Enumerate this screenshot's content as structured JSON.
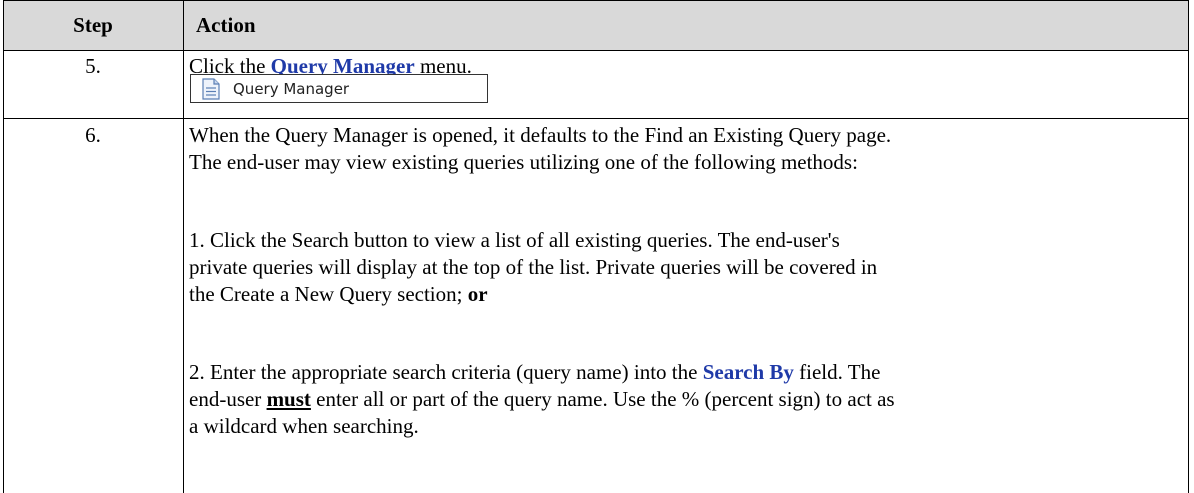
{
  "header": {
    "step": "Step",
    "action": "Action"
  },
  "rows": [
    {
      "step": "5.",
      "pre": "Click the ",
      "bold": "Query Manager",
      "post": " menu.",
      "image_label": "Query Manager"
    },
    {
      "step": "6.",
      "intro_line1": "When the Query Manager is opened, it defaults to the Find an Existing Query page.",
      "intro_line2": "The end-user may view existing queries utilizing one of the following methods:",
      "m1_line1": "1. Click the Search button to view a list of all existing queries. The end-user's",
      "m1_line2": "private queries will display at the top of the list. Private queries will be covered in",
      "m1_line3a": "the Create a New Query section; ",
      "m1_line3b": "or",
      "m2_line1a": "2. Enter the appropriate search criteria (query name) into the ",
      "m2_line1b": "Search By",
      "m2_line1c": " field. The",
      "m2_line2a": "end-user ",
      "m2_line2b": "must",
      "m2_line2c": " enter all or part of the query name. Use the % (percent sign) to act as",
      "m2_line3": "a wildcard when searching."
    }
  ],
  "icons": {
    "menu_image": "document-icon"
  }
}
